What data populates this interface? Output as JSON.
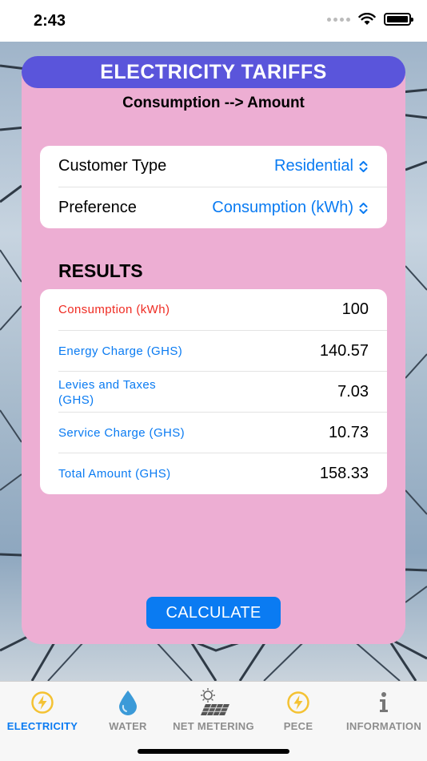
{
  "status": {
    "time": "2:43"
  },
  "header": {
    "title": "ELECTRICITY TARIFFS",
    "subtitle": "Consumption --> Amount"
  },
  "settings": [
    {
      "label": "Customer Type",
      "value": "Residential"
    },
    {
      "label": "Preference",
      "value": "Consumption (kWh)"
    }
  ],
  "results": {
    "heading": "RESULTS",
    "rows": [
      {
        "label": "Consumption (kWh)",
        "value": "100"
      },
      {
        "label": "Energy Charge (GHS)",
        "value": "140.57"
      },
      {
        "label": "Levies and Taxes (GHS)",
        "value": "7.03"
      },
      {
        "label": "Service Charge (GHS)",
        "value": "10.73"
      },
      {
        "label": "Total Amount (GHS)",
        "value": "158.33"
      }
    ]
  },
  "calculate_label": "CALCULATE",
  "tabs": [
    {
      "label": "ELECTRICITY",
      "icon": "lightning-icon",
      "active": true
    },
    {
      "label": "WATER",
      "icon": "water-drop-icon",
      "active": false
    },
    {
      "label": "NET METERING",
      "icon": "solar-panel-icon",
      "active": false
    },
    {
      "label": "PECE",
      "icon": "lightning-icon",
      "active": false
    },
    {
      "label": "INFORMATION",
      "icon": "info-icon",
      "active": false
    }
  ],
  "colors": {
    "accent": "#0a7bf2",
    "card_pink": "#edaed3",
    "title_purple": "#5a55db",
    "consumption_red": "#ef2b22",
    "tab_inactive": "#8e8e8e"
  }
}
